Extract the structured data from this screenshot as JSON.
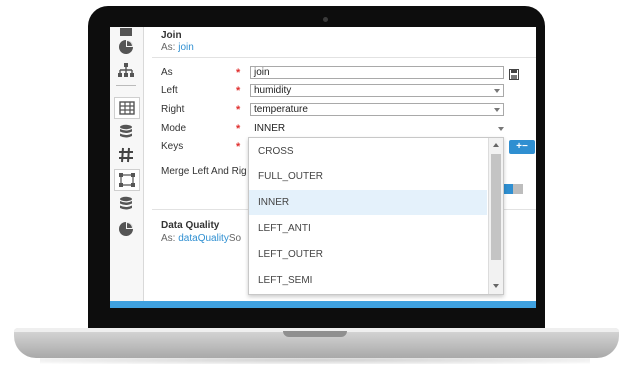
{
  "join_card": {
    "title": "Join",
    "as_prefix": "As:",
    "as_link": "join",
    "fields": {
      "as_label": "As",
      "as_value": "join",
      "left_label": "Left",
      "left_value": "humidity",
      "right_label": "Right",
      "right_value": "temperature",
      "mode_label": "Mode",
      "mode_value": "INNER",
      "keys_label": "Keys",
      "merge_label": "Merge Left And Rig",
      "required_mark": "*"
    },
    "add_key_label": "+−"
  },
  "mode_dropdown": {
    "options": [
      "CROSS",
      "FULL_OUTER",
      "INNER",
      "LEFT_ANTI",
      "LEFT_OUTER",
      "LEFT_SEMI"
    ],
    "selected": "INNER"
  },
  "quality_card": {
    "title": "Data Quality",
    "as_prefix": "As:",
    "as_link": "dataQuality",
    "trailing": "So"
  },
  "sidebar": {
    "tools": [
      "pie-chart-icon",
      "hierarchy-icon",
      "table-icon",
      "database-icon",
      "hash-icon",
      "graph-nodes-icon",
      "database-icon",
      "pie-chart-icon"
    ]
  },
  "colors": {
    "accent": "#2f8fd1",
    "required": "#e0302f",
    "bar": "#3fa1e0"
  }
}
